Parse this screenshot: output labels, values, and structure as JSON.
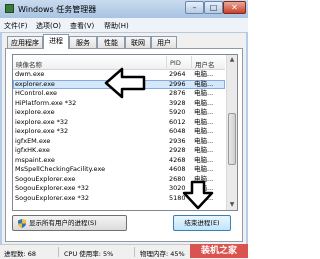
{
  "window": {
    "title": "Windows 任务管理器",
    "min_label": "–",
    "max_label": "□",
    "close_label": "✕"
  },
  "menu": [
    "文件(F)",
    "选项(O)",
    "查看(V)",
    "帮助(H)"
  ],
  "tabs": [
    "应用程序",
    "进程",
    "服务",
    "性能",
    "联网",
    "用户"
  ],
  "active_tab": "进程",
  "columns": {
    "name": "映像名称",
    "pid": "PID",
    "user": "用户名"
  },
  "processes": [
    {
      "name": "dwm.exe",
      "pid": "2964",
      "user": "电脑..."
    },
    {
      "name": "explorer.exe",
      "pid": "2996",
      "user": "电脑...",
      "selected": true
    },
    {
      "name": "HControl.exe",
      "pid": "2876",
      "user": "电脑..."
    },
    {
      "name": "HiPlatform.exe *32",
      "pid": "3928",
      "user": "电脑..."
    },
    {
      "name": "iexplore.exe",
      "pid": "5920",
      "user": "电脑..."
    },
    {
      "name": "iexplore.exe *32",
      "pid": "6012",
      "user": "电脑..."
    },
    {
      "name": "iexplore.exe *32",
      "pid": "6048",
      "user": "电脑..."
    },
    {
      "name": "igfxEM.exe",
      "pid": "2936",
      "user": "电脑..."
    },
    {
      "name": "igfxHK.exe",
      "pid": "2928",
      "user": "电脑..."
    },
    {
      "name": "mspaint.exe",
      "pid": "4268",
      "user": "电脑..."
    },
    {
      "name": "MsSpellCheckingFacility.exe",
      "pid": "4608",
      "user": "电脑..."
    },
    {
      "name": "SogouExplorer.exe",
      "pid": "2680",
      "user": "电脑..."
    },
    {
      "name": "SogouExplorer.exe *32",
      "pid": "3020",
      "user": "电脑..."
    },
    {
      "name": "SogouExplorer.exe *32",
      "pid": "5180",
      "user": "电脑..."
    }
  ],
  "buttons": {
    "show_all": "显示所有用户的进程(S)",
    "end_process": "结束进程(E)"
  },
  "status": {
    "processes": "进程数: 68",
    "cpu": "CPU 使用率: 5%",
    "memory": "物理内存: 45%"
  },
  "watermark": "装机之家",
  "colors": {
    "selected_row": "#d5e7fb",
    "arrow_fill": "#ffffff",
    "arrow_stroke": "#000000"
  }
}
